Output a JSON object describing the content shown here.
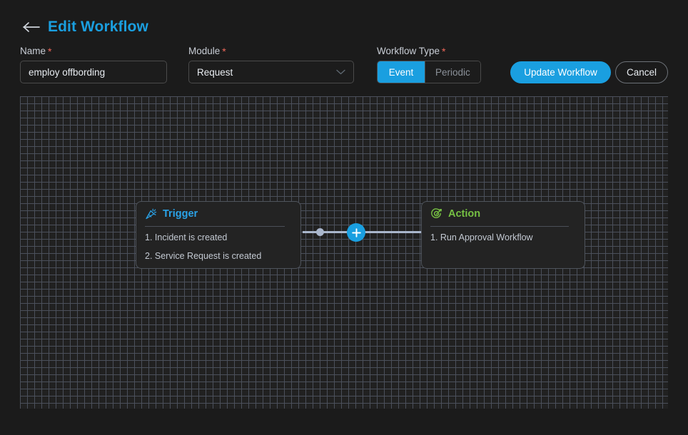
{
  "header": {
    "back_icon": "back-arrow-icon",
    "title": "Edit Workflow"
  },
  "form": {
    "name": {
      "label": "Name",
      "required_marker": "*",
      "value": "employ offbording",
      "placeholder": "Name"
    },
    "module": {
      "label": "Module",
      "required_marker": "*",
      "value": "Request",
      "chevron_icon": "chevron-down-icon"
    },
    "workflow_type": {
      "label": "Workflow Type",
      "required_marker": "*",
      "options": [
        "Event",
        "Periodic"
      ],
      "selected": "Event"
    }
  },
  "actions": {
    "primary_label": "Update Workflow",
    "secondary_label": "Cancel"
  },
  "canvas": {
    "nodes": [
      {
        "type": "trigger",
        "icon": "magic-cursor-icon",
        "title": "Trigger",
        "items": [
          "1. Incident is created",
          "2. Service Request is created"
        ]
      },
      {
        "type": "action",
        "icon": "target-dart-icon",
        "title": "Action",
        "items": [
          "1. Run Approval Workflow"
        ]
      }
    ],
    "connector": {
      "add_icon": "plus-icon",
      "handle_icon": "connection-dot-icon"
    }
  },
  "colors": {
    "accent_blue": "#1a9fe0",
    "trigger_blue": "#2aa3e8",
    "action_green": "#76c043",
    "required_red": "#f0685a",
    "canvas_bg": "#212121",
    "page_bg": "#1b1b1b"
  }
}
